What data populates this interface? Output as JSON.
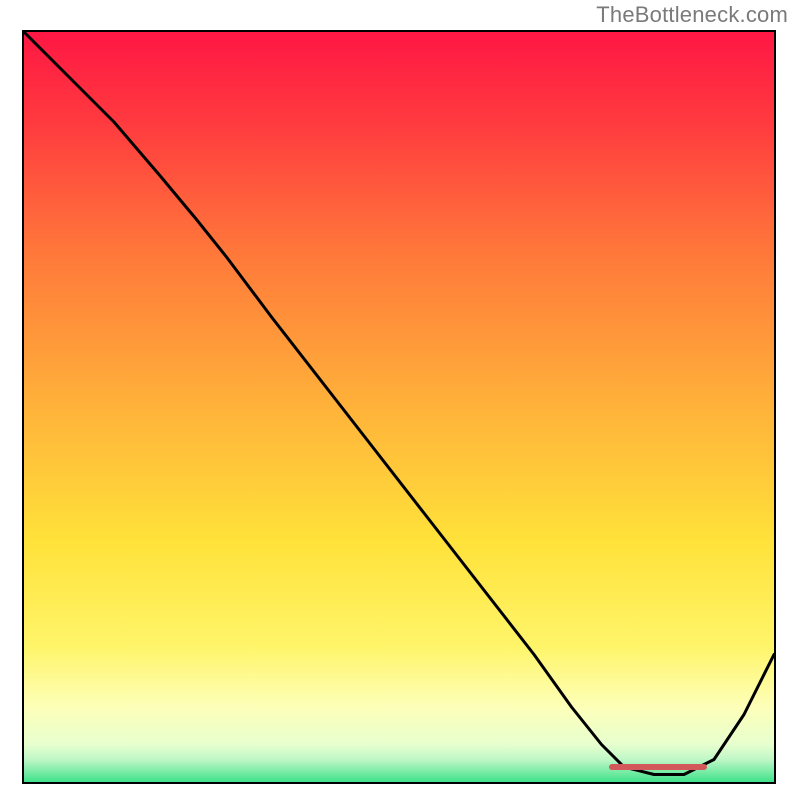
{
  "attribution": "TheBottleneck.com",
  "colors": {
    "top": "#ff1744",
    "mid_top": "#ff7a3a",
    "mid": "#ffe23a",
    "mid_bot": "#fdffb8",
    "bottom": "#3fe28a",
    "curve": "#000000",
    "marker": "#d2585a",
    "frame": "#000000"
  },
  "chart_data": {
    "type": "line",
    "title": "",
    "xlabel": "",
    "ylabel": "",
    "xlim": [
      0,
      100
    ],
    "ylim": [
      0,
      100
    ],
    "series": [
      {
        "name": "bottleneck-curve",
        "x": [
          0,
          6,
          12,
          18,
          23,
          27,
          33,
          40,
          47,
          54,
          61,
          68,
          73,
          77,
          80,
          84,
          88,
          92,
          96,
          100
        ],
        "y": [
          100,
          94,
          88,
          81,
          75,
          70,
          62,
          53,
          44,
          35,
          26,
          17,
          10,
          5,
          2,
          1,
          1,
          3,
          9,
          17
        ]
      }
    ],
    "optimal_range": {
      "x_start": 78,
      "x_end": 91,
      "y": 2
    },
    "annotations": []
  }
}
